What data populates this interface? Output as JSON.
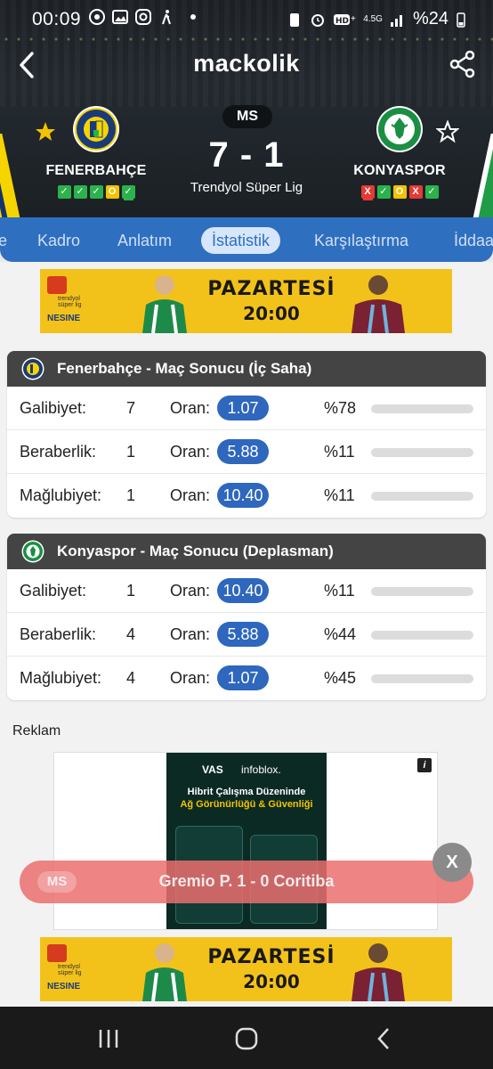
{
  "status_bar": {
    "time": "00:09",
    "network": "4.5G",
    "battery": "%24"
  },
  "header": {
    "brand": "mackolik",
    "status_pill": "MS",
    "score": "7 - 1",
    "league": "Trendyol Süper Lig",
    "home": {
      "name": "FENERBAHÇE",
      "form": [
        "w",
        "w",
        "w",
        "d",
        "w"
      ],
      "form_marks": [
        "✓",
        "✓",
        "✓",
        "O",
        "✓"
      ]
    },
    "away": {
      "name": "KONYASPOR",
      "form": [
        "l",
        "w",
        "d",
        "l",
        "w"
      ],
      "form_marks": [
        "X",
        "✓",
        "O",
        "X",
        "✓"
      ]
    }
  },
  "tabs": [
    {
      "label": "e"
    },
    {
      "label": "Kadro"
    },
    {
      "label": "Anlatım"
    },
    {
      "label": "İstatistik",
      "active": true
    },
    {
      "label": "Karşılaştırma"
    },
    {
      "label": "İddaa"
    }
  ],
  "banner": {
    "brand_top": "trendyol süper lig",
    "brand_bottom": "NESINE",
    "day": "PAZARTESİ",
    "hour": "20:00"
  },
  "home_stats": {
    "title": "Fenerbahçe - Maç Sonucu (İç Saha)",
    "rows": [
      {
        "label": "Galibiyet:",
        "count": "7",
        "oran": "Oran:",
        "odd": "1.07",
        "pct": "%78",
        "fill": 0.78
      },
      {
        "label": "Beraberlik:",
        "count": "1",
        "oran": "Oran:",
        "odd": "5.88",
        "pct": "%11",
        "fill": 0.11
      },
      {
        "label": "Mağlubiyet:",
        "count": "1",
        "oran": "Oran:",
        "odd": "10.40",
        "pct": "%11",
        "fill": 0.11
      }
    ]
  },
  "away_stats": {
    "title": "Konyaspor - Maç Sonucu (Deplasman)",
    "rows": [
      {
        "label": "Galibiyet:",
        "count": "1",
        "oran": "Oran:",
        "odd": "10.40",
        "pct": "%11",
        "fill": 0.11
      },
      {
        "label": "Beraberlik:",
        "count": "4",
        "oran": "Oran:",
        "odd": "5.88",
        "pct": "%44",
        "fill": 0.44
      },
      {
        "label": "Mağlubiyet:",
        "count": "4",
        "oran": "Oran:",
        "odd": "1.07",
        "pct": "%45",
        "fill": 0.45
      }
    ]
  },
  "ad": {
    "label": "Reklam",
    "brand_a": "VAS",
    "brand_b": "infoblox.",
    "headline_1": "Hibrit Çalışma Düzeninde",
    "headline_2": "Ağ Görünürlüğü & Güvenliği",
    "info": "i"
  },
  "live_match": {
    "status": "MS",
    "text": "Gremio P.   1 - 0  Coritiba",
    "close": "X"
  },
  "colors": {
    "primary_blue": "#2f6fc0",
    "odd_pill": "#2e67bd",
    "win": "#2bb24c",
    "draw": "#f2c300",
    "loss": "#e53935"
  }
}
